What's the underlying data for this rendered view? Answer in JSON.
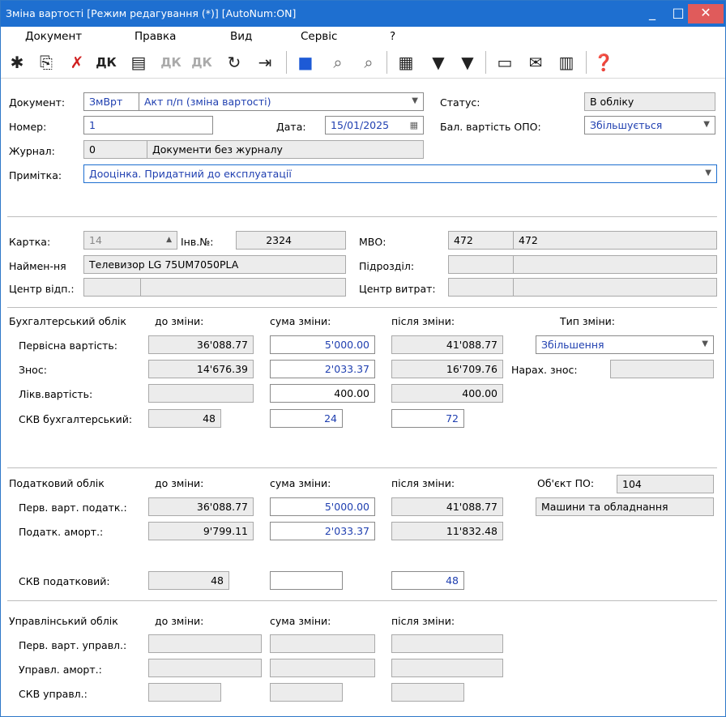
{
  "window": {
    "title": "Зміна вартості [Режим редагування (*)] [AutoNum:ON]",
    "minimize": "_",
    "maximize": "□",
    "close": "✕"
  },
  "menu": [
    "Документ",
    "Правка",
    "Вид",
    "Сервіс",
    "?"
  ],
  "toolbar_icons": [
    "new-doc",
    "copy-doc",
    "delete-doc",
    "dk",
    "list",
    "dk-gray",
    "dk-gray2",
    "refresh",
    "exit",
    "save",
    "find",
    "find-next",
    "grid",
    "filter",
    "filter-clear",
    "note",
    "mail",
    "library",
    "help"
  ],
  "document": {
    "doc_label": "Документ:",
    "doc_code": "ЗмВрт",
    "doc_type": "Акт п/п (зміна вартості)",
    "status_label": "Статус:",
    "status_value": "В обліку",
    "number_label": "Номер:",
    "number_value": "1",
    "date_label": "Дата:",
    "date_value": "15/01/2025",
    "balance_label": "Бал. вартість ОПО:",
    "balance_value": "Збільшується",
    "journal_label": "Журнал:",
    "journal_code": "0",
    "journal_name": "Документи без журналу",
    "note_label": "Примітка:",
    "note_value": "Дооцінка. Придатний до експлуатації"
  },
  "card": {
    "card_label": "Картка:",
    "card_value": "14",
    "inv_label": "Інв.№:",
    "inv_value": "2324",
    "mvo_label": "МВО:",
    "mvo_code": "472",
    "mvo_name": "472",
    "name_label": "Наймен-ня",
    "name_value": "Телевизор LG 75UM7050PLA",
    "dept_label": "Підрозділ:",
    "resp_label": "Центр відп.:",
    "cost_label": "Центр витрат:"
  },
  "accounting": {
    "header": "Бухгалтерський облік",
    "col_before": "до зміни:",
    "col_change": "сума зміни:",
    "col_after": "після зміни:",
    "change_type_label": "Тип зміни:",
    "change_type_value": "Збільшення",
    "accrual_label": "Нарах. знос:",
    "rows": [
      {
        "label": "Первісна вартість:",
        "before": "36'088.77",
        "change": "5'000.00",
        "after": "41'088.77"
      },
      {
        "label": "Знос:",
        "before": "14'676.39",
        "change": "2'033.37",
        "after": "16'709.76"
      },
      {
        "label": "Лікв.вартість:",
        "before": "",
        "change": "400.00",
        "after": "400.00"
      },
      {
        "label": "СКВ бухгалтерський:",
        "before": "48",
        "change": "24",
        "after": "72"
      }
    ]
  },
  "tax": {
    "header": "Податковий облік",
    "col_before": "до зміни:",
    "col_change": "сума зміни:",
    "col_after": "після зміни:",
    "object_label": "Об'єкт ПО:",
    "object_code": "104",
    "object_name": "Машини та обладнання",
    "rows": [
      {
        "label": "Перв. варт. податк.:",
        "before": "36'088.77",
        "change": "5'000.00",
        "after": "41'088.77"
      },
      {
        "label": "Податк. аморт.:",
        "before": "9'799.11",
        "change": "2'033.37",
        "after": "11'832.48"
      },
      {
        "label": "СКВ податковий:",
        "before": "48",
        "change": "",
        "after": "48"
      }
    ]
  },
  "management": {
    "header": "Управлінський облік",
    "col_before": "до зміни:",
    "col_change": "сума зміни:",
    "col_after": "після зміни:",
    "rows": [
      {
        "label": "Перв. варт. управл.:"
      },
      {
        "label": "Управл. аморт.:"
      },
      {
        "label": "СКВ управл.:"
      }
    ]
  }
}
